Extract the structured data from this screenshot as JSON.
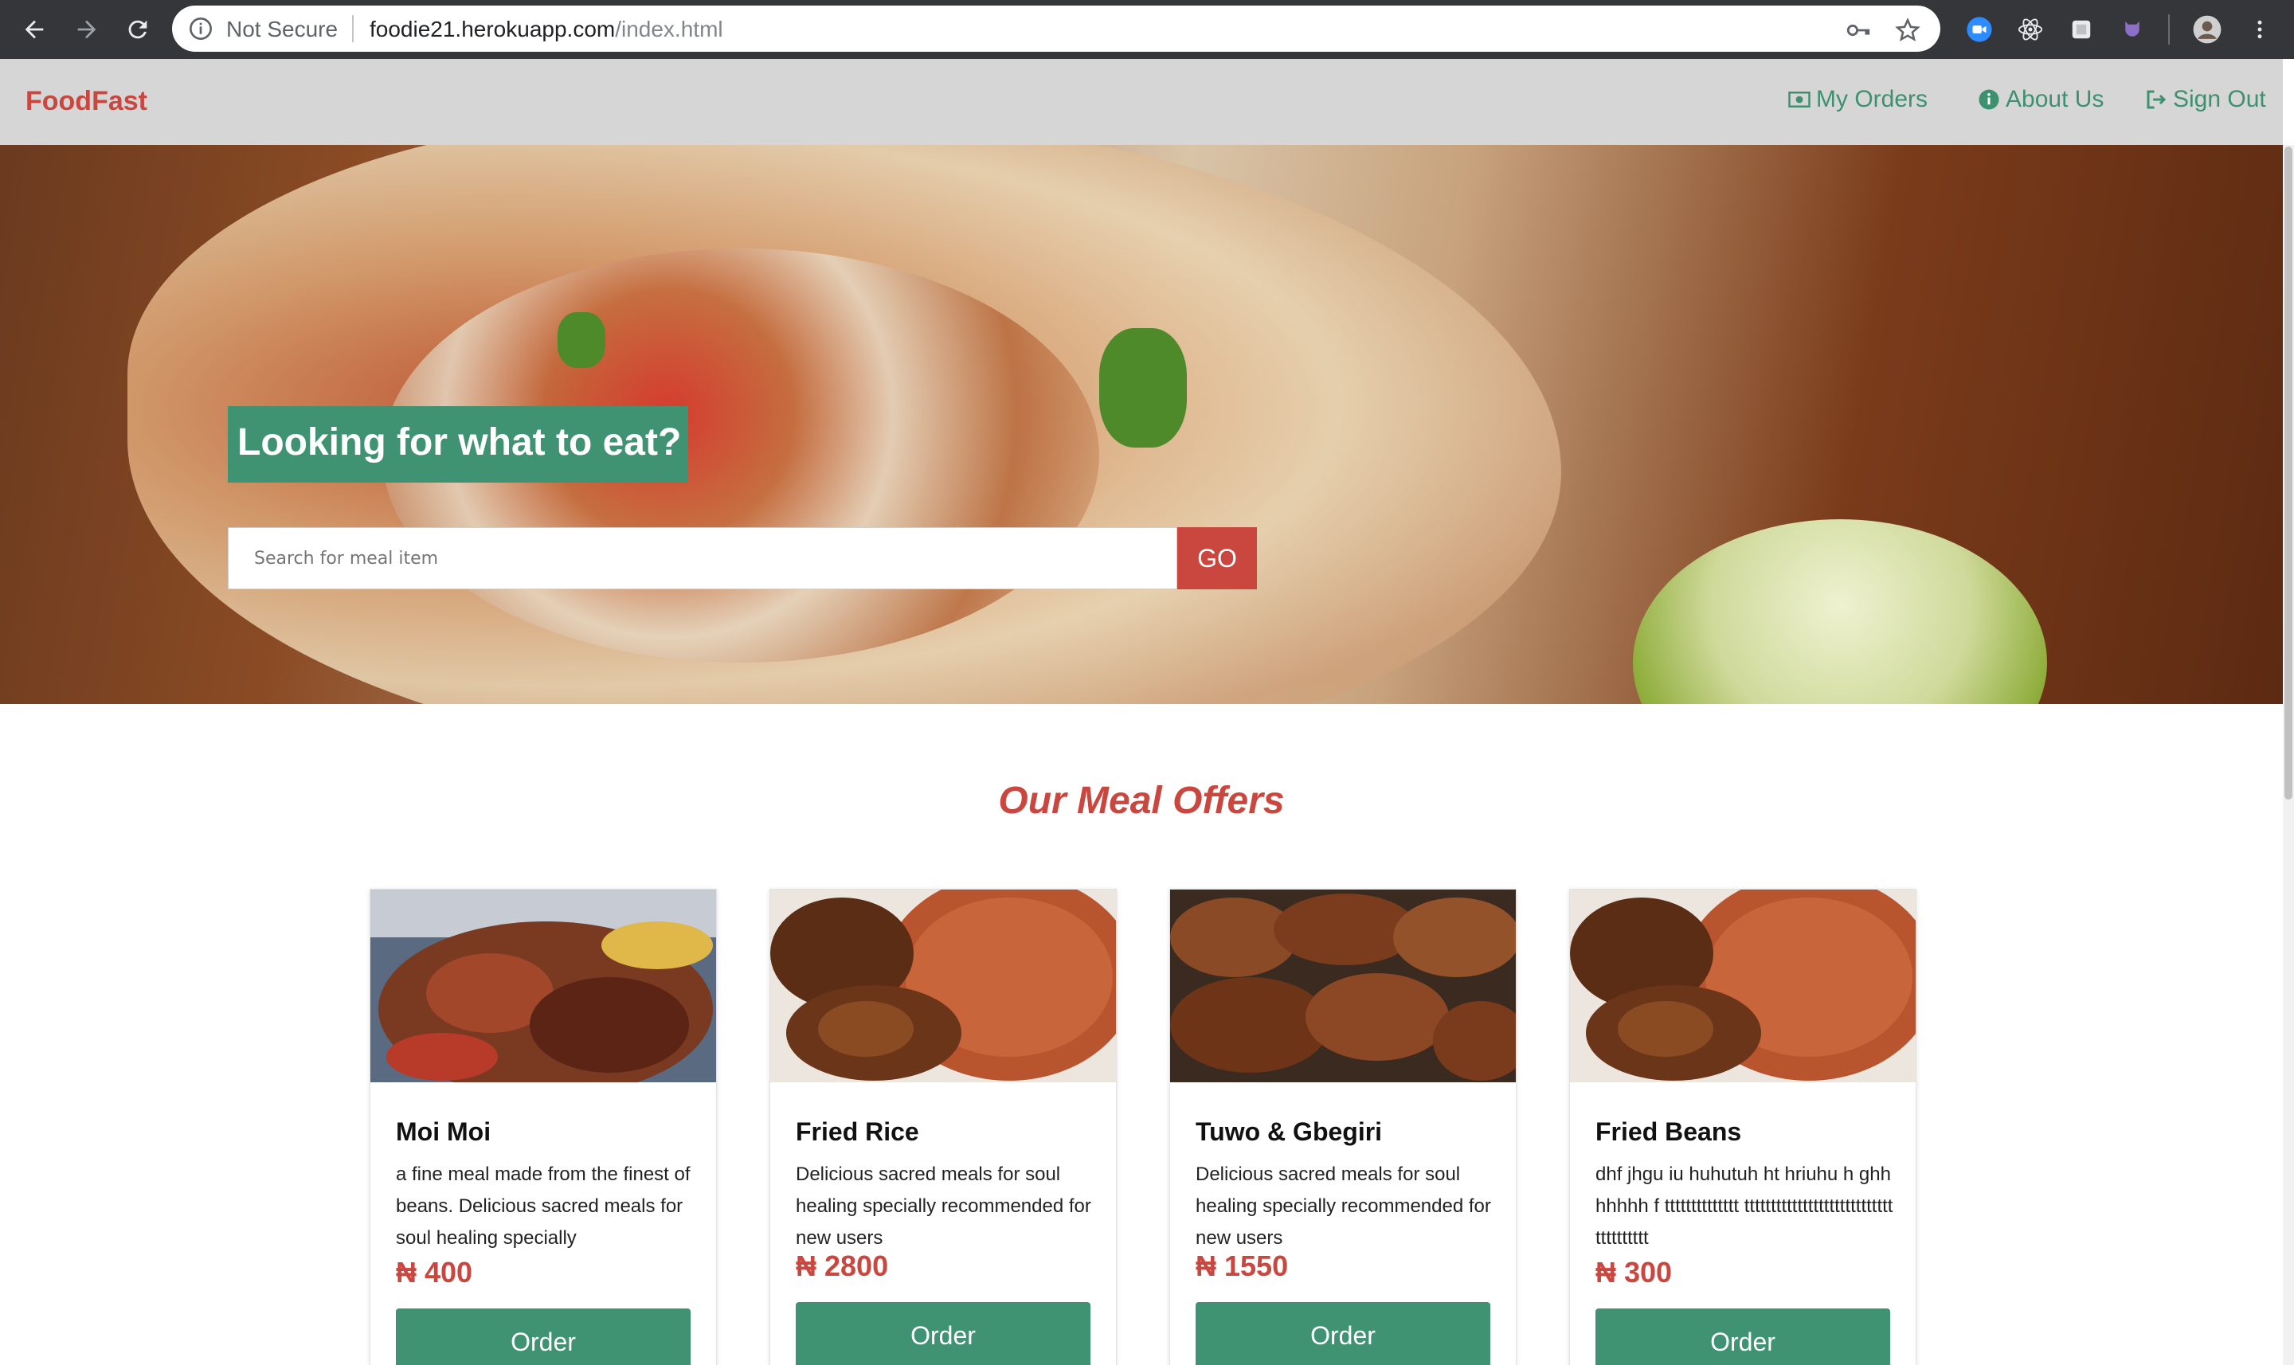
{
  "browser": {
    "security_label": "Not Secure",
    "url_host": "foodie21.herokuapp.com",
    "url_path": "/index.html"
  },
  "navbar": {
    "brand": "FoodFast",
    "links": [
      {
        "label": "My Orders",
        "icon": "money-icon"
      },
      {
        "label": "About Us",
        "icon": "info-icon"
      },
      {
        "label": "Sign Out",
        "icon": "sign-out-icon"
      }
    ]
  },
  "hero": {
    "title": "Looking for what to eat?",
    "search_placeholder": "Search for meal item",
    "go_label": "GO"
  },
  "offers": {
    "title": "Our Meal Offers",
    "currency": "₦",
    "order_label": "Order",
    "items": [
      {
        "name": "Moi Moi",
        "description": "a fine meal made from the finest of beans. Delicious sacred meals for soul healing specially",
        "price": "₦ 400"
      },
      {
        "name": "Fried Rice",
        "description": "Delicious sacred meals for soul healing specially recommended for new users",
        "price": "₦ 2800"
      },
      {
        "name": "Tuwo & Gbegiri",
        "description": "Delicious sacred meals for soul healing specially recommended for new users",
        "price": "₦ 1550"
      },
      {
        "name": "Fried Beans",
        "description": "dhf jhgu iu huhutuh ht hriuhu h ghhhhhhh f tttttttttttttt tttttttttttttttttttttttttttttttttttttt",
        "price": "₦ 300"
      }
    ]
  },
  "colors": {
    "brand_red": "#c9473f",
    "brand_green": "#3f9272",
    "navbar_bg": "#d6d6d6"
  }
}
